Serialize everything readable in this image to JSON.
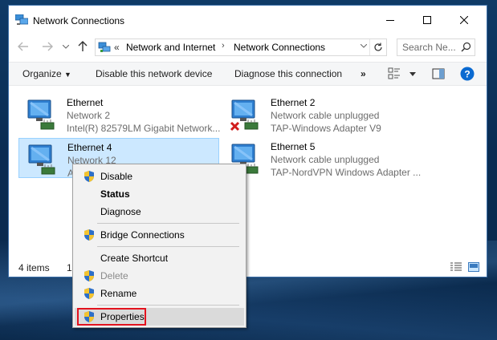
{
  "window": {
    "title": "Network Connections"
  },
  "address": {
    "overflow": "«",
    "crumbs": [
      "Network and Internet",
      "Network Connections"
    ],
    "search_placeholder": "Search Ne..."
  },
  "toolbar": {
    "organize": "Organize",
    "disable": "Disable this network device",
    "diagnose": "Diagnose this connection",
    "more": "»"
  },
  "connections": [
    {
      "name": "Ethernet",
      "status": "Network  2",
      "adapter": "Intel(R) 82579LM Gigabit Network..."
    },
    {
      "name": "Ethernet 2",
      "status": "Network cable unplugged",
      "adapter": "TAP-Windows Adapter V9"
    },
    {
      "name": "Ethernet 4",
      "status": "Network 12",
      "adapter": "A"
    },
    {
      "name": "Ethernet 5",
      "status": "Network cable unplugged",
      "adapter": "TAP-NordVPN Windows Adapter ..."
    }
  ],
  "status": {
    "count": "4 items",
    "selected": "1"
  },
  "context_menu": {
    "items": [
      {
        "label": "Disable",
        "icon": "uac-shield-icon"
      },
      {
        "label": "Status",
        "icon": ""
      },
      {
        "label": "Diagnose",
        "icon": ""
      },
      {
        "label": "Bridge Connections",
        "icon": "uac-shield-icon"
      },
      {
        "label": "Create Shortcut",
        "icon": ""
      },
      {
        "label": "Delete",
        "icon": "uac-shield-icon"
      },
      {
        "label": "Rename",
        "icon": "uac-shield-icon"
      },
      {
        "label": "Properties",
        "icon": "uac-shield-icon"
      }
    ]
  },
  "colors": {
    "selection": "#cce8ff",
    "highlight_border": "#e3121e",
    "accent": "#0078d7"
  }
}
